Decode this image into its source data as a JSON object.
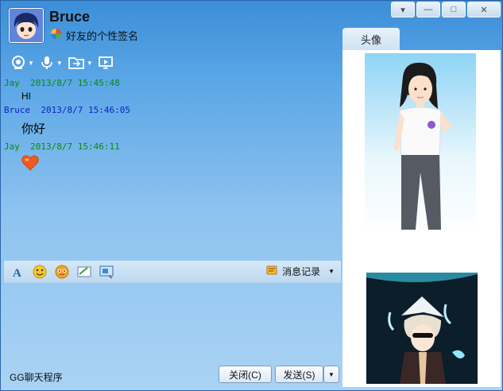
{
  "header": {
    "name": "Bruce",
    "signature": "好友的个性签名",
    "avatar_icon": "cartoon-avatar-icon"
  },
  "window_controls": {
    "menu_glyph": "▾",
    "minimize_glyph": "—",
    "maximize_glyph": "□",
    "close_glyph": "✕"
  },
  "right_panel": {
    "tab_label": "头像"
  },
  "toolbar": {
    "items": [
      "webcam-icon",
      "microphone-icon",
      "file-transfer-icon",
      "screen-share-icon"
    ]
  },
  "messages": [
    {
      "sender": "Jay",
      "time": "2013/8/7 15:45:48",
      "text": "HI",
      "color": "#0a8a0a"
    },
    {
      "sender": "Bruce",
      "time": "2013/8/7 15:46:05",
      "text": "你好",
      "color": "#1020c0"
    },
    {
      "sender": "Jay",
      "time": "2013/8/7 15:46:11",
      "text": "",
      "emoji": "heart-icon",
      "color": "#0a8a0a"
    }
  ],
  "input_toolbar": {
    "history_label": "消息记录",
    "icons": [
      "font-icon",
      "smiley-icon",
      "emoji-pack-icon",
      "handwriting-icon",
      "screenshot-icon"
    ]
  },
  "bottom": {
    "app_label": "GG聊天程序",
    "close_label": "关闭(C)",
    "send_label": "发送(S)"
  }
}
